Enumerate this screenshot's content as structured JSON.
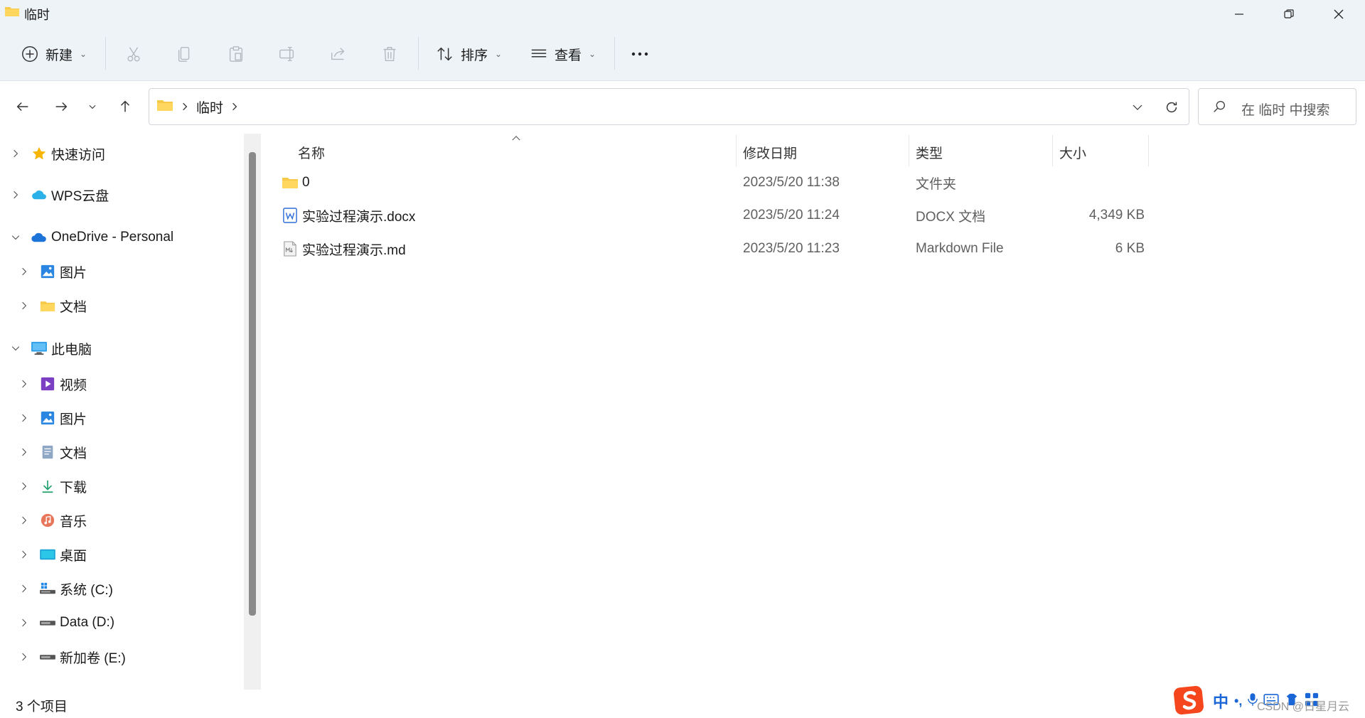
{
  "window": {
    "title": "临时",
    "controls": {
      "minimize": "minimize",
      "restore": "restore",
      "close": "close"
    }
  },
  "toolbar": {
    "new_label": "新建",
    "sort_label": "排序",
    "view_label": "查看",
    "more_label": "•••"
  },
  "address": {
    "path_item": "临时",
    "search_placeholder": "在 临时 中搜索"
  },
  "navpane": {
    "items": [
      {
        "label": "快速访问",
        "icon": "star-icon",
        "level": 0,
        "expanded": false
      },
      {
        "label": "WPS云盘",
        "icon": "wps-cloud-icon",
        "level": 0,
        "expanded": false
      },
      {
        "label": "OneDrive - Personal",
        "icon": "onedrive-icon",
        "level": 0,
        "expanded": true
      },
      {
        "label": "图片",
        "icon": "pictures-icon",
        "level": 1,
        "expanded": false
      },
      {
        "label": "文档",
        "icon": "folder-icon",
        "level": 1,
        "expanded": false
      },
      {
        "label": "此电脑",
        "icon": "computer-icon",
        "level": 0,
        "expanded": true
      },
      {
        "label": "视频",
        "icon": "videos-icon",
        "level": 1,
        "expanded": false
      },
      {
        "label": "图片",
        "icon": "pictures-icon",
        "level": 1,
        "expanded": false
      },
      {
        "label": "文档",
        "icon": "documents-icon",
        "level": 1,
        "expanded": false
      },
      {
        "label": "下载",
        "icon": "download-icon",
        "level": 1,
        "expanded": false
      },
      {
        "label": "音乐",
        "icon": "music-icon",
        "level": 1,
        "expanded": false
      },
      {
        "label": "桌面",
        "icon": "desktop-icon",
        "level": 1,
        "expanded": false
      },
      {
        "label": "系统 (C:)",
        "icon": "system-drive-icon",
        "level": 1,
        "expanded": false
      },
      {
        "label": "Data (D:)",
        "icon": "drive-icon",
        "level": 1,
        "expanded": false
      },
      {
        "label": "新加卷 (E:)",
        "icon": "drive-icon",
        "level": 1,
        "expanded": false
      }
    ]
  },
  "filelist": {
    "columns": {
      "name": "名称",
      "modified": "修改日期",
      "type": "类型",
      "size": "大小"
    },
    "rows": [
      {
        "name": "0",
        "modified": "2023/5/20 11:38",
        "type": "文件夹",
        "size": "",
        "icon": "folder-icon"
      },
      {
        "name": "实验过程演示.docx",
        "modified": "2023/5/20 11:24",
        "type": "DOCX 文档",
        "size": "4,349 KB",
        "icon": "docx-icon"
      },
      {
        "name": "实验过程演示.md",
        "modified": "2023/5/20 11:23",
        "type": "Markdown File",
        "size": "6 KB",
        "icon": "markdown-icon"
      }
    ]
  },
  "status": {
    "item_count": "3 个项目"
  },
  "ime": {
    "mode": "中",
    "punct": "•,"
  },
  "watermark": "CSDN @日星月云"
}
